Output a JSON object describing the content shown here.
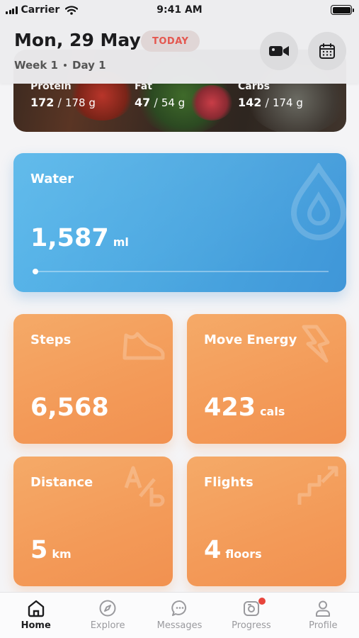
{
  "status": {
    "carrier": "Carrier",
    "time": "9:41 AM"
  },
  "header": {
    "date": "Mon, 29 May",
    "today_badge": "TODAY",
    "week": "Week 1",
    "day": "Day 1",
    "icons": [
      "video-camera-icon",
      "calendar-icon"
    ]
  },
  "macros": [
    {
      "label": "Protein",
      "value": "172",
      "goal": "178 g"
    },
    {
      "label": "Fat",
      "value": "47",
      "goal": "54 g"
    },
    {
      "label": "Carbs",
      "value": "142",
      "goal": "174 g"
    }
  ],
  "water": {
    "title": "Water",
    "value": "1,587",
    "unit": "ml",
    "progress": 0.02
  },
  "stats": [
    {
      "title": "Steps",
      "value": "6,568",
      "unit": "",
      "icon": "shoe-icon"
    },
    {
      "title": "Move Energy",
      "value": "423",
      "unit": "cals",
      "icon": "lightning-icon"
    },
    {
      "title": "Distance",
      "value": "5",
      "unit": "km",
      "icon": "a-to-b-icon"
    },
    {
      "title": "Flights",
      "value": "4",
      "unit": "floors",
      "icon": "stairs-icon"
    }
  ],
  "tabs": [
    {
      "label": "Home",
      "icon": "home-icon",
      "active": true
    },
    {
      "label": "Explore",
      "icon": "compass-icon",
      "active": false
    },
    {
      "label": "Messages",
      "icon": "chat-bubble-icon",
      "active": false
    },
    {
      "label": "Progress",
      "icon": "progress-camera-icon",
      "active": false,
      "badge": true
    },
    {
      "label": "Profile",
      "icon": "person-icon",
      "active": false
    }
  ],
  "colors": {
    "accent_red": "#e4574f",
    "water_blue": "#4aa6e0",
    "stat_orange": "#f39a58",
    "badge_red": "#e8453c"
  }
}
